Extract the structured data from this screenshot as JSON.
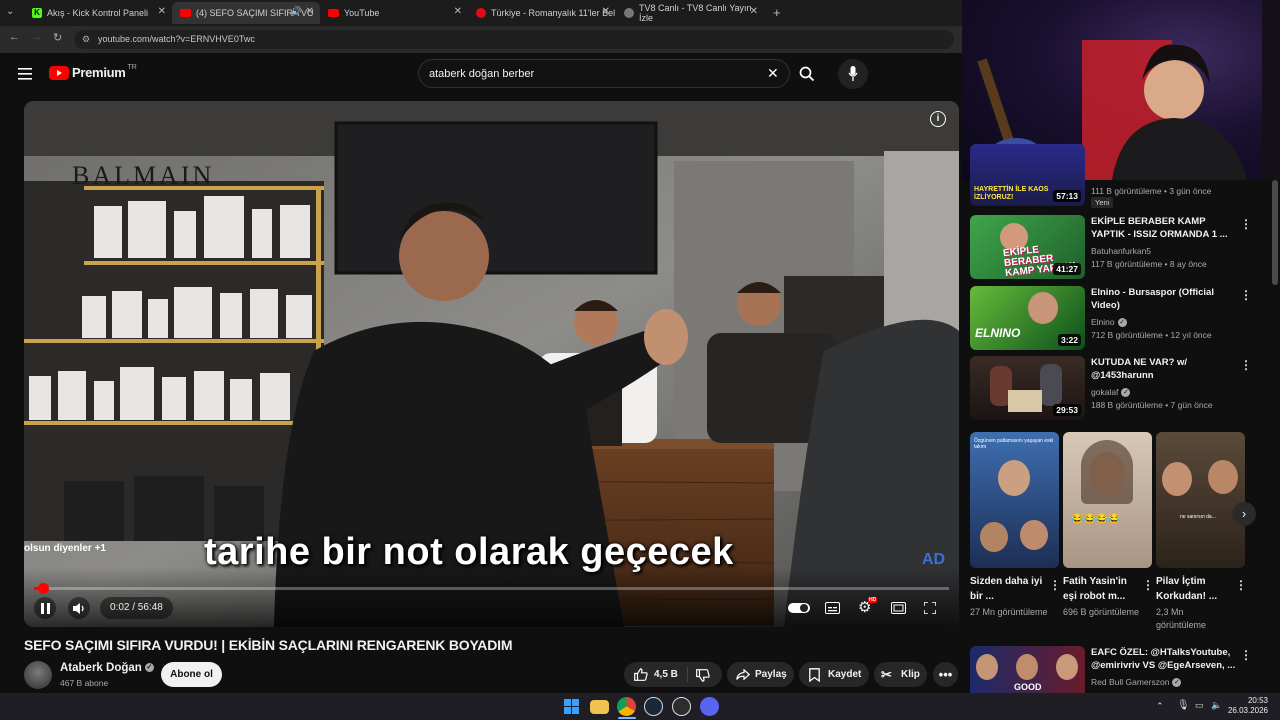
{
  "browser": {
    "tabs": [
      {
        "label": "Akış - Kick Kontrol Paneli",
        "color": "#53fc18"
      },
      {
        "label": "(4) SEFO SAÇIMI SIFIRA VU",
        "color": "#ff0000"
      },
      {
        "label": "YouTube",
        "color": "#ff0000"
      },
      {
        "label": "Türkiye - Romanyalık 11'ler Bel",
        "color": "#e30a17"
      },
      {
        "label": "TV8 Canlı - TV8 Canlı Yayın İzle",
        "color": "#888888"
      }
    ],
    "url": "youtube.com/watch?v=ERNVHVE0Twc"
  },
  "header": {
    "logo_text": "Premium",
    "region": "TR",
    "search_value": "ataberk doğan berber"
  },
  "player": {
    "subtitle": "tarihe bir not olarak geçecek",
    "overlay_text": "olsun diyenler +1",
    "brand_sign": "BALMAIN",
    "time": "0:02 / 56:48",
    "progress_fraction": 0.0006
  },
  "video": {
    "title": "SEFO SAÇIMI SIFIRA VURDU! | EKİBİN SAÇLARINI RENGARENK BOYADIM",
    "channel": "Ataberk Doğan",
    "subscribers": "467 B abone",
    "subscribe_label": "Abone ol",
    "likes": "4,5 B",
    "share_label": "Paylaş",
    "save_label": "Kaydet",
    "clip_label": "Klip"
  },
  "sidebar": {
    "partial_item": {
      "thumb_text": "HAYRETTİN İLE KAOS İZLİYORUZ!",
      "duration": "57:13",
      "meta": "111 B görüntüleme • 3 gün önce",
      "badge": "Yeni"
    },
    "items": [
      {
        "title": "EKİPLE BERABER KAMP YAPTIK - ISSIZ ORMANDA 1 ...",
        "channel": "Batuhanfurkan5",
        "meta": "117 B görüntüleme • 8 ay önce",
        "duration": "41:27",
        "thumb_text": "EKİPLE BERABER KAMP YAPTIK!"
      },
      {
        "title": "Elnino - Bursaspor (Official Video)",
        "channel": "Elnino",
        "meta": "712 B görüntüleme • 12 yıl önce",
        "duration": "3:22",
        "thumb_text": "ELNINO"
      },
      {
        "title": "KUTUDA NE VAR? w/ @1453harunn",
        "channel": "gokalaf",
        "meta": "188 B görüntüleme • 7 gün önce",
        "duration": "29:53",
        "thumb_text": ""
      }
    ],
    "shorts": [
      {
        "title": "Sizden daha iyi bir ...",
        "views": "27 Mn görüntüleme",
        "thumb_text": "Özgürven patlamasını yaşayan eski takım"
      },
      {
        "title": "Fatih Yasin'in eşi robot m...",
        "views": "696 B görüntüleme",
        "thumb_text": "😂😂😂😂"
      },
      {
        "title": "Pilav İçtim Korkudan! ...",
        "views": "2,3 Mn görüntüleme",
        "thumb_text": "ne sanırsın da..."
      }
    ],
    "last_item": {
      "title": "EAFC ÖZEL: @HTalksYoutube, @emirivriv VS @EgeArseven, ...",
      "channel": "Red Bull Gamerszon",
      "thumb_text": "GOOD"
    }
  },
  "taskbar": {
    "time": "20:53",
    "date": "26.03.2026"
  }
}
